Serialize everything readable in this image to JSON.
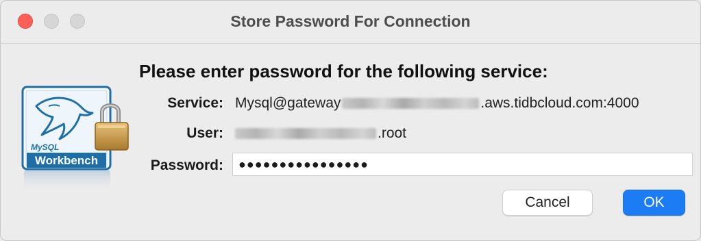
{
  "window": {
    "title": "Store Password For Connection"
  },
  "dialog": {
    "headline": "Please enter password for the following service:",
    "service_label": "Service:",
    "service_prefix": "Mysql@gateway",
    "service_suffix": ".aws.tidbcloud.com:4000",
    "user_label": "User:",
    "user_suffix": ".root",
    "password_label": "Password:",
    "password_masked": "●●●●●●●●●●●●●●●●"
  },
  "logo": {
    "small_text": "MySQL",
    "big_text": "Workbench",
    "icon": "mysql-workbench-lock-icon"
  },
  "buttons": {
    "cancel": "Cancel",
    "ok": "OK"
  },
  "colors": {
    "close": "#fe5f57",
    "ok_button": "#1b7cf4",
    "logo_blue": "#1e6fa8"
  }
}
